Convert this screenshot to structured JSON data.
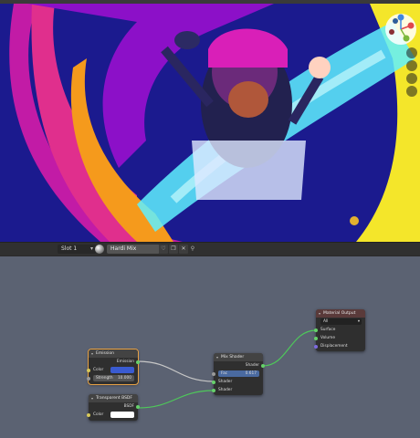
{
  "viewport": {
    "nav_icons": [
      "gizmo-axes-icon",
      "zoom-icon",
      "hand-pan-icon",
      "camera-view-icon",
      "perspective-grid-icon"
    ]
  },
  "header": {
    "slot_label": "Slot 1",
    "material_name": "Hardi Mix",
    "icons": [
      "material-sphere-icon",
      "fake-user-shield-icon",
      "duplicate-icon",
      "close-icon",
      "pin-icon"
    ]
  },
  "nodes": {
    "emission": {
      "title": "Emission",
      "output": "Emission",
      "color_label": "Color",
      "color_value": "#3a5bd0",
      "strength_label": "Strength",
      "strength_value": "10.000"
    },
    "transparent": {
      "title": "Transparent BSDF",
      "output": "BSDF",
      "color_label": "Color",
      "color_value": "#ffffff"
    },
    "mix": {
      "title": "Mix Shader",
      "output": "Shader",
      "fac_label": "Fac",
      "fac_value": "0.617",
      "shader1": "Shader",
      "shader2": "Shader"
    },
    "output": {
      "title": "Material Output",
      "target": "All",
      "surface": "Surface",
      "volume": "Volume",
      "displacement": "Displacement"
    }
  }
}
